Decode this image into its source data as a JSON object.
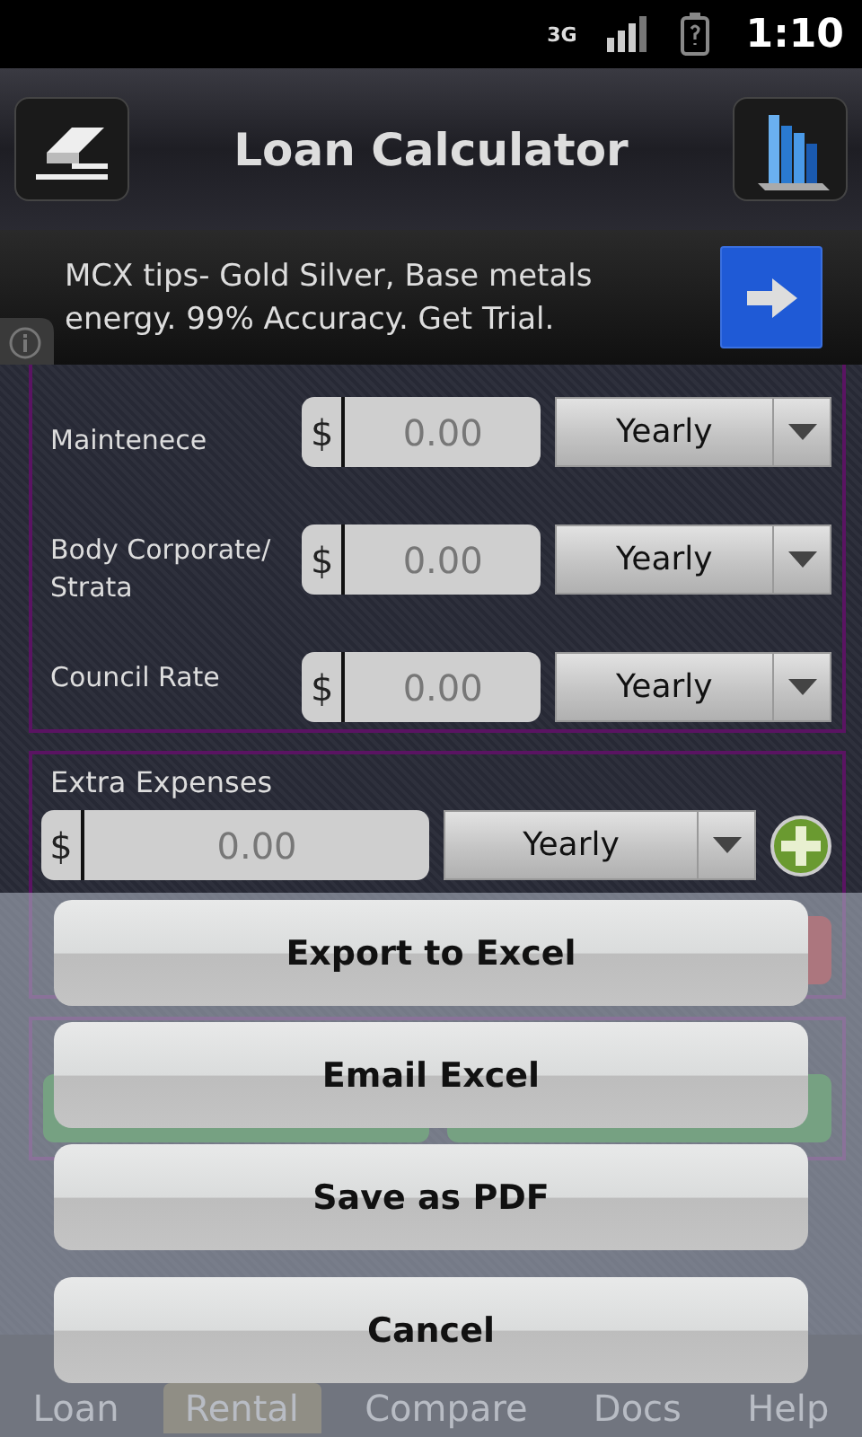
{
  "status_bar": {
    "network": "3G",
    "time": "1:10"
  },
  "title_bar": {
    "title": "Loan Calculator"
  },
  "ad": {
    "text": "MCX tips- Gold Silver, Base metals energy. 99% Accuracy. Get Trial."
  },
  "cost_rows": [
    {
      "label": "Maintenece",
      "currency": "$",
      "value": "0.00",
      "period": "Yearly"
    },
    {
      "label": "Body Corporate/ Strata",
      "currency": "$",
      "value": "0.00",
      "period": "Yearly"
    },
    {
      "label": "Council Rate",
      "currency": "$",
      "value": "0.00",
      "period": "Yearly"
    }
  ],
  "extra_expenses": {
    "title": "Extra Expenses",
    "currency": "$",
    "value": "0.00",
    "period": "Yearly"
  },
  "action_sheet": {
    "buttons": [
      "Export to Excel",
      "Email Excel",
      "Save as PDF",
      "Cancel"
    ]
  },
  "tabs": [
    {
      "label": "Loan",
      "selected": false
    },
    {
      "label": "Rental",
      "selected": true
    },
    {
      "label": "Compare",
      "selected": false
    },
    {
      "label": "Docs",
      "selected": false
    },
    {
      "label": "Help",
      "selected": false
    }
  ]
}
